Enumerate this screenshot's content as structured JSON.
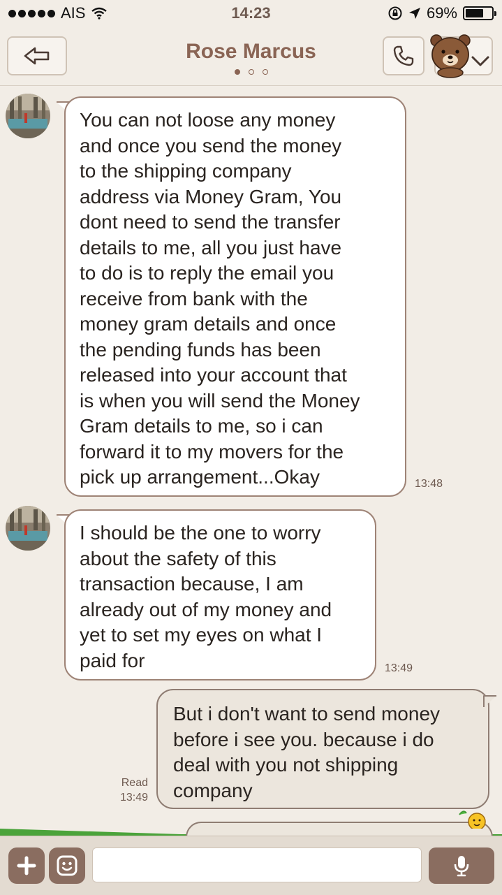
{
  "status_bar": {
    "carrier": "AIS",
    "time": "14:23",
    "battery": "69%",
    "battery_level": 0.69,
    "icons": [
      "signal-dots-icon",
      "wifi-icon",
      "orientation-lock-icon",
      "location-arrow-icon",
      "battery-icon"
    ]
  },
  "header": {
    "title": "Rose Marcus",
    "page_count": 3,
    "active_page": 1,
    "icons": [
      "back-arrow-icon",
      "phone-icon",
      "bear-sticker-icon",
      "chevron-down-icon"
    ]
  },
  "messages": [
    {
      "direction": "incoming",
      "lines": [
        "You can not loose any money",
        "and once you send the money",
        "to the shipping company",
        "address via Money Gram, You",
        "dont need to send the transfer",
        "details to me, all you just have",
        "to do is to reply the email you",
        "receive from bank with the",
        "money gram details and once",
        "the pending funds has been",
        "released into your account that",
        "is when you will send the Money",
        "Gram details to me, so i can",
        "forward it to my movers for the",
        "pick up arrangement...Okay"
      ],
      "time": "13:48"
    },
    {
      "direction": "incoming",
      "lines": [
        "I should be the one to worry",
        "about the safety of this",
        "transaction because, I am",
        "already out of my money and",
        "yet to set my eyes on what I",
        "paid for"
      ],
      "time": "13:49"
    },
    {
      "direction": "outgoing",
      "lines": [
        "But i don't want to send money",
        "before i see you. because i do",
        "deal with you not shipping",
        "company"
      ],
      "read_label": "Read",
      "time": "13:49"
    }
  ],
  "footer": {
    "input_value": "",
    "icons": [
      "plus-icon",
      "emoticon-icon",
      "microphone-icon"
    ]
  },
  "colors": {
    "background": "#f2ede6",
    "accent_brown": "#8a6454",
    "button_brown": "#8a6d60",
    "bubble_border": "#9e8376"
  }
}
